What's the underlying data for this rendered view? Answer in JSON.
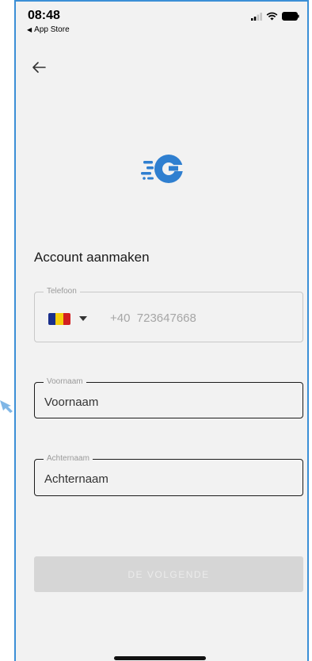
{
  "status": {
    "time": "08:48",
    "back_app": "App Store"
  },
  "brand": {
    "accent": "#2f7fd0"
  },
  "page": {
    "title": "Account aanmaken"
  },
  "phone_field": {
    "legend": "Telefoon",
    "country": "Romania",
    "value": "+40  723647668"
  },
  "firstname_field": {
    "legend": "Voornaam",
    "value": "Voornaam"
  },
  "lastname_field": {
    "legend": "Achternaam",
    "value": "Achternaam"
  },
  "next_button": {
    "label": "DE VOLGENDE",
    "enabled": false
  }
}
